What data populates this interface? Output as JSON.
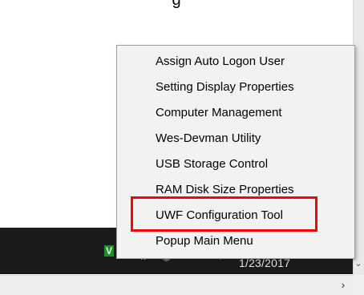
{
  "context_menu": {
    "items": [
      {
        "label": "Assign Auto Logon User"
      },
      {
        "label": "Setting Display Properties"
      },
      {
        "label": "Computer Management"
      },
      {
        "label": "Wes-Devman Utility"
      },
      {
        "label": "USB Storage Control"
      },
      {
        "label": "RAM Disk Size Properties"
      },
      {
        "label": "UWF Configuration Tool"
      },
      {
        "label": "Popup Main Menu"
      }
    ],
    "highlighted_item": "UWF Configuration Tool",
    "highlight_color": "#ff0000"
  },
  "taskbar": {
    "clock_date": "1/23/2017",
    "background_color": "#1b1b1b",
    "tray_icons": [
      "app-icon",
      "network-icon",
      "volume-icon",
      "language-icon",
      "flag-icon",
      "notification-icon"
    ]
  },
  "top_text": "g",
  "scrollbars": {
    "vertical_down_glyph": "⌄",
    "horizontal_right_glyph": "›"
  }
}
